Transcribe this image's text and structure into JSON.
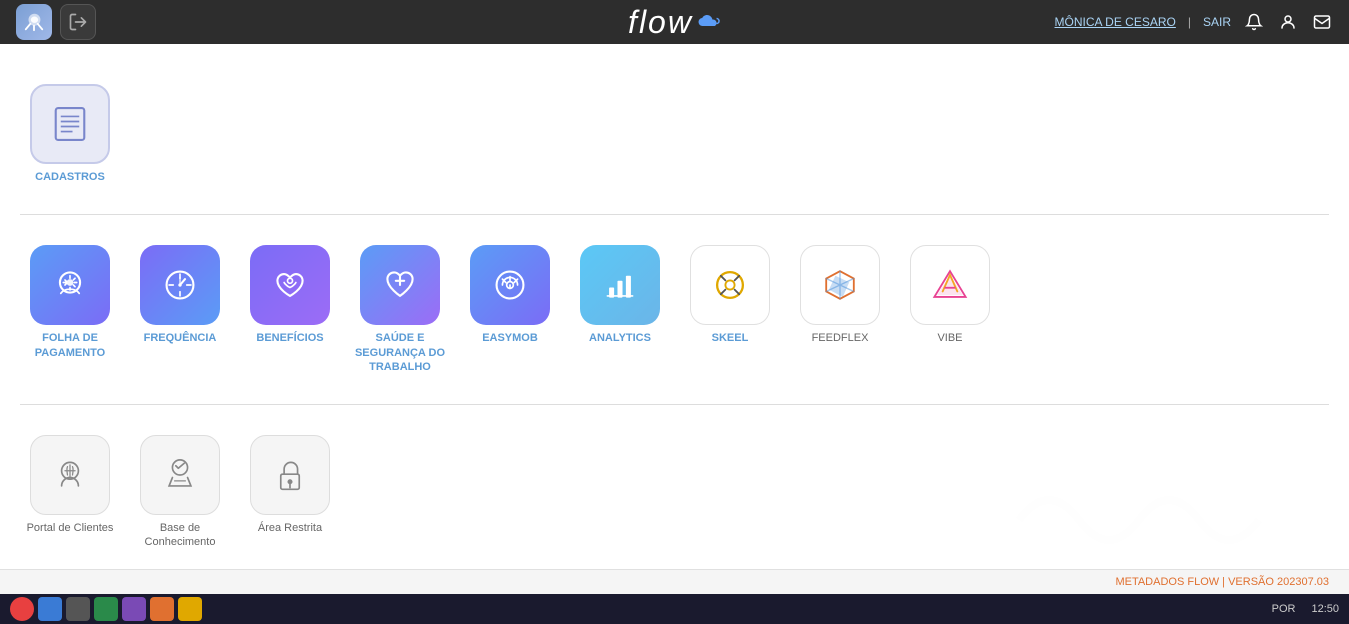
{
  "topnav": {
    "logo": "flow",
    "user_name": "MÔNICA DE CESARO",
    "separator": "|",
    "sair": "SAIR"
  },
  "sections": [
    {
      "id": "cadastros",
      "apps": [
        {
          "id": "cadastros",
          "label": "CADASTROS",
          "icon_type": "cadastros",
          "label_color": "blue"
        }
      ]
    },
    {
      "id": "main-apps",
      "apps": [
        {
          "id": "folha",
          "label": "FOLHA DE PAGAMENTO",
          "icon_type": "folha",
          "label_color": "blue"
        },
        {
          "id": "frequencia",
          "label": "FREQUÊNCIA",
          "icon_type": "frequencia",
          "label_color": "blue"
        },
        {
          "id": "beneficios",
          "label": "BENEFÍCIOS",
          "icon_type": "beneficios",
          "label_color": "blue"
        },
        {
          "id": "saude",
          "label": "SAÚDE E SEGURANÇA DO TRABALHO",
          "icon_type": "saude",
          "label_color": "blue"
        },
        {
          "id": "easymob",
          "label": "EASYMOB",
          "icon_type": "easymob",
          "label_color": "blue"
        },
        {
          "id": "analytics",
          "label": "ANALYTICS",
          "icon_type": "analytics",
          "label_color": "blue"
        },
        {
          "id": "skeel",
          "label": "SKEEL",
          "icon_type": "skeel",
          "label_color": "blue"
        },
        {
          "id": "feedflex",
          "label": "FEEDFLEX",
          "icon_type": "feedflex",
          "label_color": "gray"
        },
        {
          "id": "vibe",
          "label": "VIBE",
          "icon_type": "vibe",
          "label_color": "gray"
        }
      ]
    },
    {
      "id": "support-apps",
      "apps": [
        {
          "id": "portal",
          "label": "Portal de Clientes",
          "icon_type": "portal",
          "label_color": "gray"
        },
        {
          "id": "base",
          "label": "Base de Conhecimento",
          "icon_type": "base",
          "label_color": "gray"
        },
        {
          "id": "restrita",
          "label": "Área Restrita",
          "icon_type": "restrita",
          "label_color": "gray"
        }
      ]
    }
  ],
  "footer": {
    "text": "METADADOS FLOW | VERSÃO 202307.03"
  },
  "taskbar": {
    "time": "12:50",
    "lang": "POR"
  }
}
